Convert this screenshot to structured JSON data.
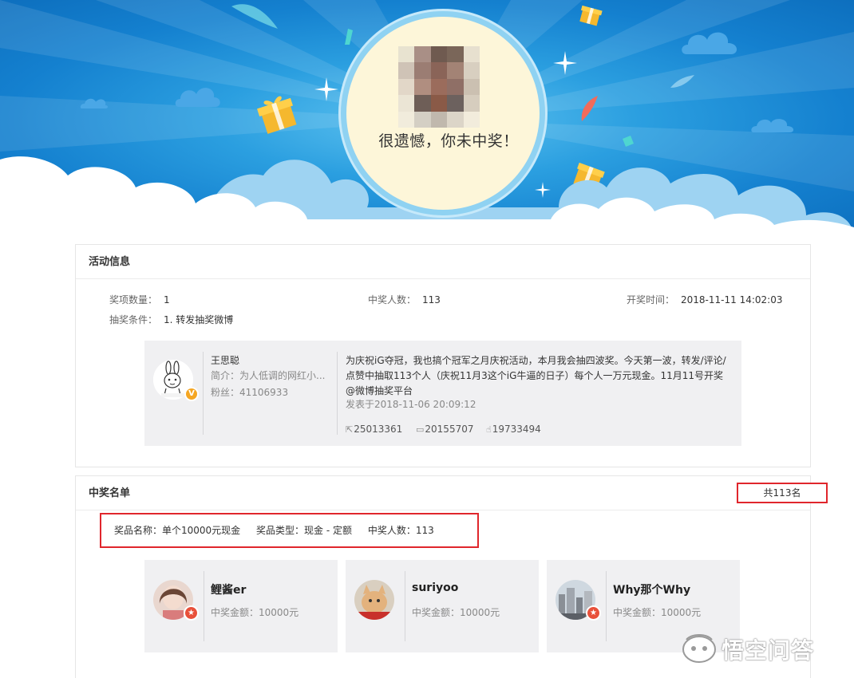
{
  "banner": {
    "result_text": "很遗憾，你未中奖！"
  },
  "activity": {
    "title": "活动信息",
    "prize_count_label": "奖项数量：",
    "prize_count": "1",
    "winner_count_label": "中奖人数：",
    "winner_count": "113",
    "draw_time_label": "开奖时间：",
    "draw_time": "2018-11-11 14:02:03",
    "condition_label": "抽奖条件：",
    "condition": "1. 转发抽奖微博"
  },
  "weibo": {
    "user_name": "王思聪",
    "intro": "简介：为人低调的网红小...",
    "fans": "粉丝：41106933",
    "text": "为庆祝iG夺冠，我也搞个冠军之月庆祝活动，本月我会抽四波奖。今天第一波，转发/评论/点赞中抽取113个人（庆祝11月3这个iG牛逼的日子）每个人一万元现金。11月11号开奖 @微博抽奖平台",
    "published": "发表于2018-11-06 20:09:12",
    "reposts": "25013361",
    "comments": "20155707",
    "likes": "19733494",
    "verified_mark": "V"
  },
  "winners_section": {
    "title": "中奖名单",
    "total": "共113名",
    "prize_name": "奖品名称：单个10000元现金",
    "prize_type": "奖品类型：现金 - 定额",
    "prize_winners": "中奖人数：113",
    "winners": [
      {
        "name": "鲤酱er",
        "amount": "中奖金额：10000元"
      },
      {
        "name": "suriyoo",
        "amount": "中奖金额：10000元"
      },
      {
        "name": "Why那个Why",
        "amount": "中奖金额：10000元"
      }
    ]
  },
  "watermark": {
    "text": "悟空问答"
  },
  "colors": {
    "banner_blue": "#1480cf",
    "highlight_red": "#e0262c",
    "card_gray": "#f0f0f2",
    "gift_yellow": "#f5b82e"
  }
}
